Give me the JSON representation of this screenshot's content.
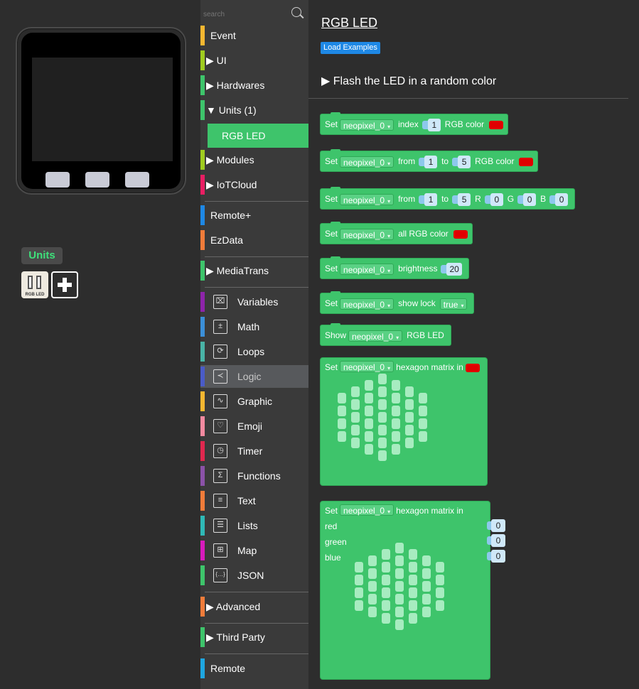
{
  "units": {
    "label": "Units",
    "icon_label": "RGB LED"
  },
  "toolbox": {
    "search_placeholder": "search",
    "categories": [
      {
        "label": "Event",
        "color": "#f5b731"
      },
      {
        "label": "UI",
        "color": "#9fcc1f"
      },
      {
        "label": "Hardwares",
        "color": "#3ec46b"
      },
      {
        "label": "Units (1)",
        "color": "#3ec46b"
      },
      {
        "label": "Modules",
        "color": "#9fcc1f"
      },
      {
        "label": "IoTCloud",
        "color": "#e91e63"
      },
      {
        "label": "Remote+",
        "color": "#1e88e5"
      },
      {
        "label": "EzData",
        "color": "#f07c3a"
      },
      {
        "label": "MediaTrans",
        "color": "#3ec46b"
      },
      {
        "label": "Variables",
        "color": "#8e24aa",
        "icon": "variables-icon"
      },
      {
        "label": "Math",
        "color": "#3b8fd8",
        "icon": "math-icon"
      },
      {
        "label": "Loops",
        "color": "#49b3a6",
        "icon": "loops-icon"
      },
      {
        "label": "Logic",
        "color": "#4a5cc7",
        "icon": "logic-icon"
      },
      {
        "label": "Graphic",
        "color": "#f5b731",
        "icon": "graphic-icon"
      },
      {
        "label": "Emoji",
        "color": "#f38aa0",
        "icon": "emoji-icon"
      },
      {
        "label": "Timer",
        "color": "#e0284f",
        "icon": "timer-icon"
      },
      {
        "label": "Functions",
        "color": "#8b52a8",
        "icon": "functions-icon"
      },
      {
        "label": "Text",
        "color": "#f07c3a",
        "icon": "text-icon"
      },
      {
        "label": "Lists",
        "color": "#2fb9b6",
        "icon": "lists-icon"
      },
      {
        "label": "Map",
        "color": "#d81bbd",
        "icon": "map-icon"
      },
      {
        "label": "JSON",
        "color": "#3ec46b",
        "icon": "json-icon"
      },
      {
        "label": "Advanced",
        "color": "#f07c3a"
      },
      {
        "label": "Third Party",
        "color": "#3ec46b"
      },
      {
        "label": "Remote",
        "color": "#1ea6e0"
      }
    ],
    "selected_sub": "RGB LED",
    "icon_glyphs": {
      "variables": "⌧",
      "math": "±",
      "loops": "⟳",
      "logic": "≺",
      "graphic": "∿",
      "emoji": "♡",
      "timer": "◷",
      "functions": "Σ",
      "text": "≡",
      "lists": "☰",
      "map": "⊞",
      "json": "{…}"
    }
  },
  "main": {
    "title": "RGB LED",
    "load_examples": "Load Examples",
    "section": "▶ Flash the LED in a random color"
  },
  "blocks": {
    "b1": {
      "set": "Set",
      "var": "neopixel_0",
      "w1": "index",
      "n1": "1",
      "w2": "RGB color"
    },
    "b2": {
      "set": "Set",
      "var": "neopixel_0",
      "w1": "from",
      "n1": "1",
      "w2": "to",
      "n2": "5",
      "w3": "RGB color"
    },
    "b3": {
      "set": "Set",
      "var": "neopixel_0",
      "w1": "from",
      "n1": "1",
      "w2": "to",
      "n2": "5",
      "r": "R",
      "rv": "0",
      "g": "G",
      "gv": "0",
      "b": "B",
      "bv": "0"
    },
    "b4": {
      "set": "Set",
      "var": "neopixel_0",
      "w1": "all RGB color"
    },
    "b5": {
      "set": "Set",
      "var": "neopixel_0",
      "w1": "brightness",
      "n1": "20"
    },
    "b6": {
      "set": "Set",
      "var": "neopixel_0",
      "w1": "show lock",
      "val": "true"
    },
    "b7": {
      "show": "Show",
      "var": "neopixel_0",
      "w1": "RGB LED"
    },
    "b8": {
      "set": "Set",
      "var": "neopixel_0",
      "w1": "hexagon matrix in"
    },
    "b9": {
      "set": "Set",
      "var": "neopixel_0",
      "w1": "hexagon matrix in",
      "red": "red",
      "green": "green",
      "blue": "blue",
      "rv": "0",
      "gv": "0",
      "bv": "0"
    }
  },
  "colors": {
    "block_green": "#3ec46b",
    "led_red": "#e10000",
    "input_blue": "#cfe8f8"
  }
}
